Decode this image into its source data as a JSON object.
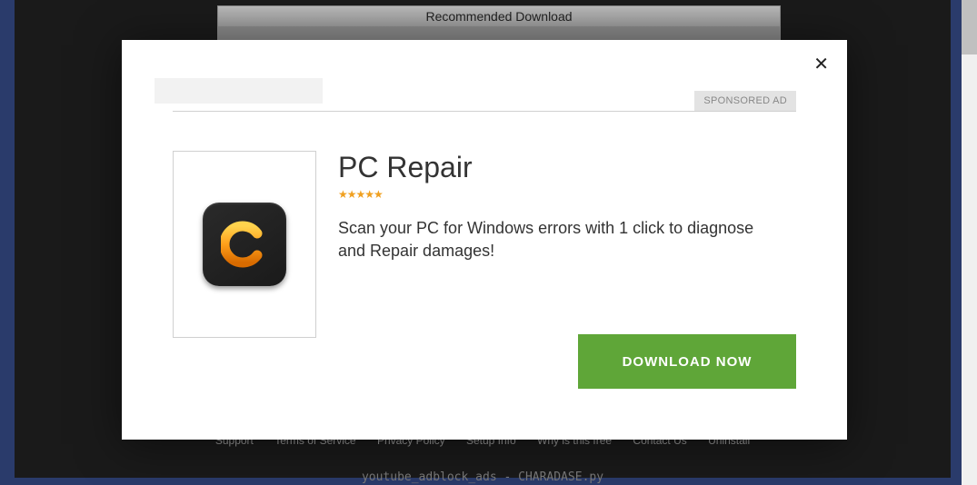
{
  "background": {
    "banner": "Recommended Download",
    "footerLinks": [
      "Support",
      "Terms of Service",
      "Privacy Policy",
      "Setup Info",
      "Why is this free",
      "Contact Us",
      "Uninstall"
    ],
    "footerCode": "youtube_adblock_ads - CHARADASE.py"
  },
  "modal": {
    "sponsoredLabel": "SPONSORED AD",
    "productTitle": "PC Repair",
    "stars": "★★★★★",
    "productDesc": "Scan your PC for Windows errors with 1 click to diagnose and Repair damages!",
    "downloadLabel": "DOWNLOAD NOW"
  }
}
